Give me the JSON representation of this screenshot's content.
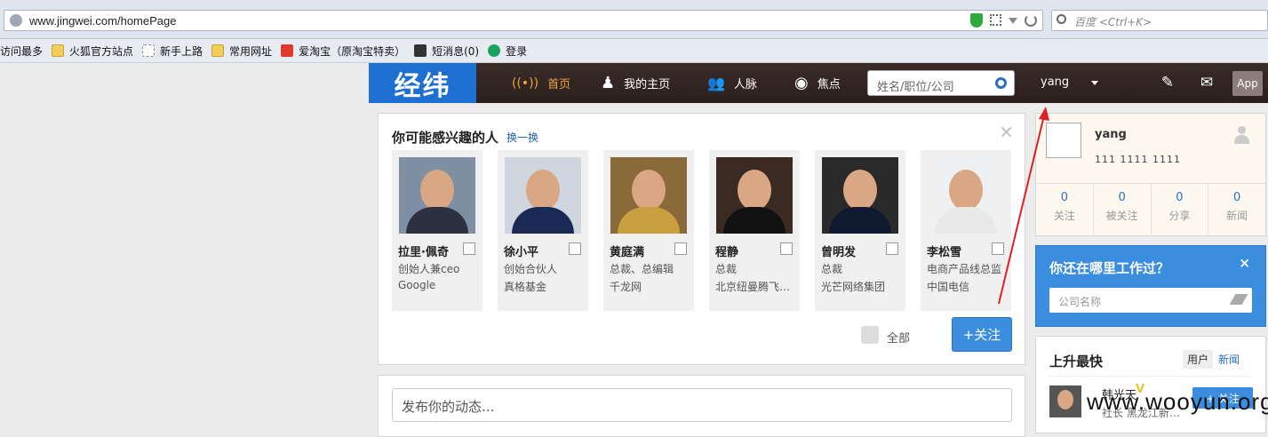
{
  "browser": {
    "url": "www.jingwei.com/homePage",
    "search_placeholder": "百度 <Ctrl+K>",
    "bookmarks": [
      {
        "label": "访问最多",
        "icon": "none"
      },
      {
        "label": "火狐官方站点",
        "icon": "folder-icon"
      },
      {
        "label": "新手上路",
        "icon": "page-icon"
      },
      {
        "label": "常用网址",
        "icon": "folder-icon"
      },
      {
        "label": "爱淘宝（原淘宝特卖）",
        "icon": "taobao-icon"
      },
      {
        "label": "短消息(0)",
        "icon": "message-icon"
      },
      {
        "label": "登录",
        "icon": "login-icon"
      }
    ]
  },
  "header": {
    "logo": "经纬",
    "nav": [
      {
        "label": "首页",
        "icon": "((•))",
        "active": true
      },
      {
        "label": "我的主页",
        "icon": "♟",
        "active": false
      },
      {
        "label": "人脉",
        "icon": "👥",
        "active": false
      },
      {
        "label": "焦点",
        "icon": "◉",
        "active": false
      }
    ],
    "search_placeholder": "姓名/职位/公司",
    "username": "yang",
    "app_label": "App",
    "edit_icon": "✎",
    "mail_icon": "✉"
  },
  "recommend": {
    "title": "你可能感兴趣的人",
    "refresh": "换一换",
    "close": "×",
    "people": [
      {
        "name": "拉里·佩奇",
        "line1": "创始人兼ceo",
        "line2": "Google"
      },
      {
        "name": "徐小平",
        "line1": "创始合伙人",
        "line2": "真格基金"
      },
      {
        "name": "黄庭满",
        "line1": "总裁、总编辑",
        "line2": "千龙网"
      },
      {
        "name": "程静",
        "line1": "总裁",
        "line2": "北京纽曼腾飞…"
      },
      {
        "name": "曾明发",
        "line1": "总裁",
        "line2": "光芒网络集团"
      },
      {
        "name": "李松雪",
        "line1": "电商产品线总监",
        "line2": "中国电信"
      }
    ],
    "all_label": "全部",
    "follow_label": "+关注"
  },
  "post": {
    "placeholder": "发布你的动态..."
  },
  "profile": {
    "name": "yang",
    "sub": "111  1111    1111",
    "stats": [
      {
        "n": "0",
        "label": "关注"
      },
      {
        "n": "0",
        "label": "被关注"
      },
      {
        "n": "0",
        "label": "分享"
      },
      {
        "n": "0",
        "label": "新闻"
      }
    ]
  },
  "work": {
    "title": "你还在哪里工作过？",
    "close": "×",
    "placeholder": "公司名称"
  },
  "rising": {
    "title": "上升最快",
    "tab_users": "用户",
    "tab_news": "新闻",
    "person_name": "韩光天",
    "verified": "V",
    "person_sub": "社长 黑龙江新…",
    "follow_label": "+ 关注"
  },
  "watermark": "www.wooyun.org",
  "colors": {
    "brand_blue": "#1e6fd2",
    "header_bg": "#2f2320",
    "active_nav": "#f0a33c",
    "button_blue": "#3b8de0",
    "annotation_red": "#e02020"
  }
}
